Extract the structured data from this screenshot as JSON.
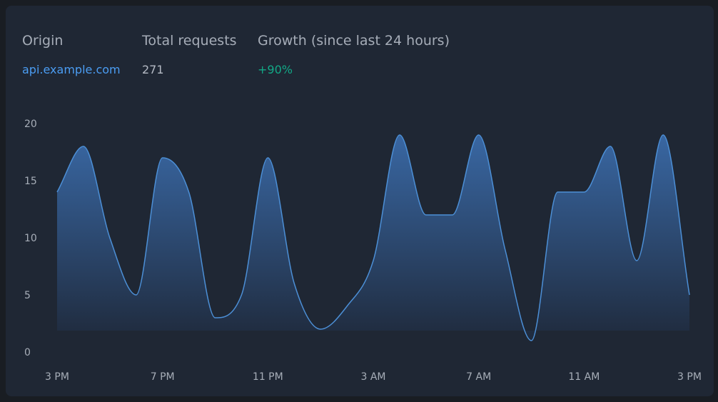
{
  "header": {
    "origin_label": "Origin",
    "total_label": "Total requests",
    "growth_label": "Growth (since last 24 hours)",
    "origin_value": "api.example.com",
    "total_value": "271",
    "growth_value": "+90%"
  },
  "colors": {
    "background": "#191d23",
    "card": "#1f2734",
    "link": "#4b9df3",
    "growth": "#12a987",
    "line": "#4c8fd6",
    "area_top": "#3a6aa8",
    "area_bottom": "#1f2a3c"
  },
  "chart_data": {
    "type": "area",
    "y_ticks": [
      "20",
      "15",
      "10",
      "5",
      "0"
    ],
    "x_ticks": [
      "3 PM",
      "7 PM",
      "11 PM",
      "3 AM",
      "7 AM",
      "11 AM",
      "3 PM"
    ],
    "ylim": [
      0,
      20
    ],
    "x_hours": [
      0,
      1,
      2,
      3,
      4,
      5,
      6,
      7,
      8,
      9,
      10,
      11,
      12,
      13,
      14,
      15,
      16,
      17,
      18,
      19,
      20,
      21,
      22,
      23,
      24
    ],
    "values": [
      14,
      18,
      10,
      5,
      17,
      14,
      3,
      5,
      17,
      6,
      2,
      4,
      8,
      19,
      12,
      12,
      19,
      9,
      1,
      14,
      14,
      18,
      8,
      19,
      5
    ],
    "grid": false,
    "legend": "none"
  }
}
